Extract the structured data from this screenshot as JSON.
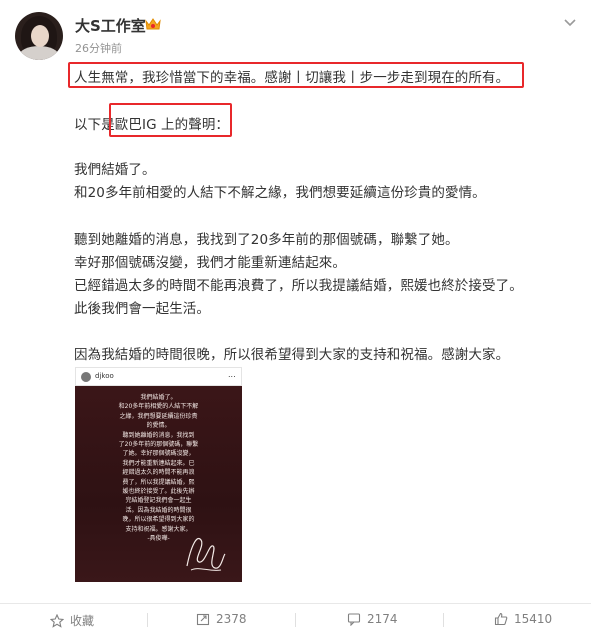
{
  "post": {
    "author": "大S工作室",
    "timestamp": "26分钟前",
    "lines": [
      "人生無常，我珍惜當下的幸福。感謝丨切讓我丨步一步走到現在的所有。",
      "以下是歐巴IG 上的聲明：",
      "我們結婚了。",
      "和20多年前相愛的人結下不解之緣，我們想要延續這份珍貴的愛情。",
      "聽到她離婚的消息，我找到了20多年前的那個號碼，聯繫了她。",
      "幸好那個號碼沒變，我們才能重新連結起來。",
      "已經錯過太多的時間不能再浪費了，所以我提議結婚，熙媛也終於接受了。",
      "此後我們會一起生活。",
      "因為我結婚的時間很晚，所以很希望得到大家的支持和祝福。感謝大家。"
    ]
  },
  "embedded_image": {
    "username": "djkoo",
    "more": "...",
    "text": "我們結婚了。\n和20多年前相愛的人結下不解\n之緣，我們想要延續這份珍貴\n的愛情。\n聽到她離婚的消息，我找到\n了20多年前的那個號碼，聯繫\n了她。幸好那個號碼沒變，\n我們才能重新連結起來。已\n經錯過太久的時間不能再浪\n費了，所以我提議結婚，熙\n媛也終於接受了。此後先辦\n完結婚登記我們會一起生\n活。因為我結婚的時間很\n晚，所以很希望得到大家的\n支持和祝福。感謝大家。\n-具俊曄-"
  },
  "actions": {
    "favorite": "收藏",
    "repost": "2378",
    "comment": "2174",
    "like": "15410"
  },
  "colors": {
    "highlight": "#e8282b",
    "accent": "#f0a020"
  }
}
